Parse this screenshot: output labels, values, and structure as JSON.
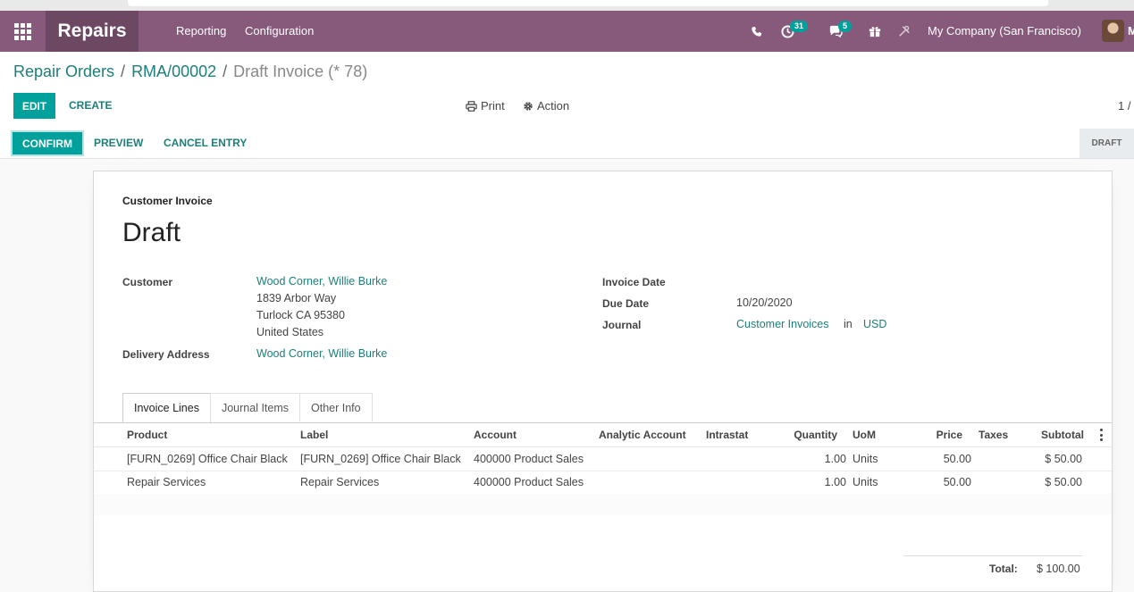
{
  "navbar": {
    "app_name": "Repairs",
    "menu": [
      "Reporting",
      "Configuration"
    ],
    "activity_count": "31",
    "message_count": "5",
    "company": "My Company (San Francisco)",
    "user_initial": "M"
  },
  "breadcrumb": {
    "items": [
      "Repair Orders",
      "RMA/00002"
    ],
    "current": "Draft Invoice (* 78)"
  },
  "control": {
    "edit_label": "EDIT",
    "create_label": "CREATE",
    "print_label": "Print",
    "action_label": "Action",
    "pager": "1 /"
  },
  "statusbar": {
    "confirm_label": "CONFIRM",
    "preview_label": "PREVIEW",
    "cancel_label": "CANCEL ENTRY",
    "state": "DRAFT"
  },
  "invoice": {
    "type": "Customer Invoice",
    "state_title": "Draft",
    "customer_label": "Customer",
    "customer_name": "Wood Corner, Willie Burke",
    "address_lines": [
      "1839 Arbor Way",
      "Turlock CA 95380",
      "United States"
    ],
    "delivery_label": "Delivery Address",
    "delivery_name": "Wood Corner, Willie Burke",
    "invoice_date_label": "Invoice Date",
    "invoice_date": "",
    "due_date_label": "Due Date",
    "due_date": "10/20/2020",
    "journal_label": "Journal",
    "journal": "Customer Invoices",
    "journal_in": "in",
    "currency": "USD"
  },
  "tabs": [
    "Invoice Lines",
    "Journal Items",
    "Other Info"
  ],
  "lines": {
    "columns": [
      "Product",
      "Label",
      "Account",
      "Analytic Account",
      "Intrastat",
      "Quantity",
      "UoM",
      "Price",
      "Taxes",
      "Subtotal"
    ],
    "rows": [
      {
        "product": "[FURN_0269] Office Chair Black",
        "label": "[FURN_0269] Office Chair Black",
        "account": "400000 Product Sales",
        "analytic": "",
        "intrastat": "",
        "quantity": "1.00",
        "uom": "Units",
        "price": "50.00",
        "taxes": "",
        "subtotal": "$ 50.00"
      },
      {
        "product": "Repair Services",
        "label": "Repair Services",
        "account": "400000 Product Sales",
        "analytic": "",
        "intrastat": "",
        "quantity": "1.00",
        "uom": "Units",
        "price": "50.00",
        "taxes": "",
        "subtotal": "$ 50.00"
      }
    ]
  },
  "totals": {
    "total_label": "Total:",
    "total_value": "$ 100.00"
  },
  "colors": {
    "navbar": "#875a7b",
    "brand_bg": "#6c4863",
    "primary": "#00a09d",
    "link": "#1c7f7a"
  }
}
